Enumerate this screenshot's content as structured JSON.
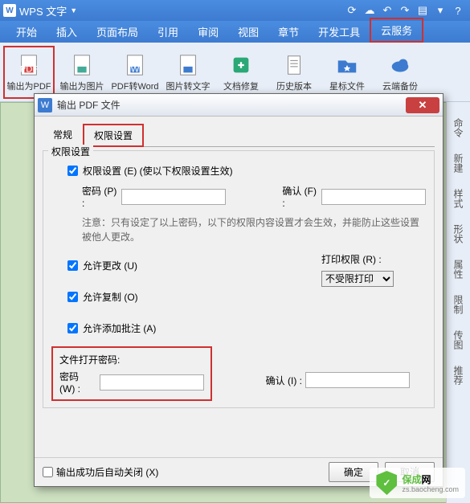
{
  "titlebar": {
    "app": "WPS 文字"
  },
  "tabs": [
    "开始",
    "插入",
    "页面布局",
    "引用",
    "审阅",
    "视图",
    "章节",
    "开发工具",
    "云服务"
  ],
  "ribbon": [
    {
      "label": "输出为PDF",
      "hl": true
    },
    {
      "label": "输出为图片"
    },
    {
      "label": "PDF转Word"
    },
    {
      "label": "图片转文字"
    },
    {
      "label": "文档修复"
    },
    {
      "label": "历史版本"
    },
    {
      "label": "星标文件"
    },
    {
      "label": "云端备份"
    }
  ],
  "side": [
    "命令",
    "新建",
    "样式",
    "形状",
    "属性",
    "限制",
    "传图",
    "推荐"
  ],
  "dialog": {
    "title": "输出 PDF 文件",
    "tabs": {
      "general": "常规",
      "perm": "权限设置"
    },
    "group_title": "权限设置",
    "perm_check": "权限设置 (E) (使以下权限设置生效)",
    "pwd_label": "密码 (P) :",
    "confirm_label": "确认 (F) :",
    "note": "注意：只有设定了以上密码，以下的权限内容设置才会生效，并能防止这些设置被他人更改。",
    "allow_edit": "允许更改 (U)",
    "allow_copy": "允许复制 (O)",
    "allow_annot": "允许添加批注 (A)",
    "print_label": "打印权限 (R) :",
    "print_value": "不受限打印",
    "open_group": "文件打开密码:",
    "open_pwd": "密码 (W) :",
    "open_confirm": "确认 (I) :",
    "auto_close": "输出成功后自动关闭 (X)",
    "ok": "确定",
    "cancel": "取消"
  },
  "watermark": {
    "brand1": "保成",
    "brand2": "网",
    "sub": "zs.baocheng.com"
  }
}
